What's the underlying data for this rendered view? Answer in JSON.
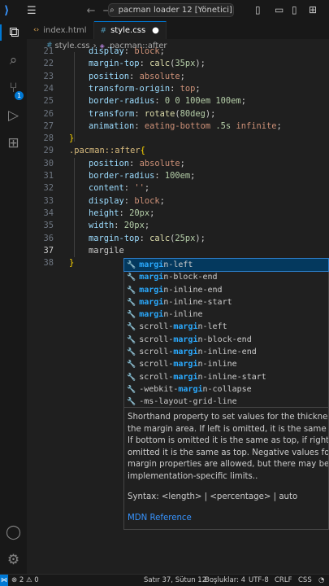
{
  "titlebar": {
    "search_text": "pacman loader 12 [Yönetici]",
    "back_icon": "arrow-left-icon",
    "forward_icon": "arrow-right-icon"
  },
  "activity_bar": {
    "source_control_badge": "1"
  },
  "tabs": [
    {
      "label": "index.html",
      "icon": "html-file-icon",
      "active": false,
      "modified": false
    },
    {
      "label": "style.css",
      "icon": "css-file-icon",
      "active": true,
      "modified": true
    }
  ],
  "breadcrumb": {
    "file": "style.css",
    "symbol": ".pacman::after"
  },
  "editor": {
    "current_line": "37",
    "lines": [
      {
        "n": "21",
        "tokens": [
          [
            "p",
            "display"
          ],
          [
            "t",
            ": "
          ],
          [
            "v",
            "block"
          ],
          [
            "t",
            ";"
          ]
        ]
      },
      {
        "n": "22",
        "tokens": [
          [
            "p",
            "margin-top"
          ],
          [
            "t",
            ": "
          ],
          [
            "f",
            "calc"
          ],
          [
            "t",
            "("
          ],
          [
            "n",
            "35px"
          ],
          [
            "t",
            ");"
          ]
        ]
      },
      {
        "n": "23",
        "tokens": [
          [
            "p",
            "position"
          ],
          [
            "t",
            ": "
          ],
          [
            "v",
            "absolute"
          ],
          [
            "t",
            ";"
          ]
        ]
      },
      {
        "n": "24",
        "tokens": [
          [
            "p",
            "transform-origin"
          ],
          [
            "t",
            ": "
          ],
          [
            "v",
            "top"
          ],
          [
            "t",
            ";"
          ]
        ]
      },
      {
        "n": "25",
        "tokens": [
          [
            "p",
            "border-radius"
          ],
          [
            "t",
            ": "
          ],
          [
            "n",
            "0 0 100em 100em"
          ],
          [
            "t",
            ";"
          ]
        ]
      },
      {
        "n": "26",
        "tokens": [
          [
            "p",
            "transform"
          ],
          [
            "t",
            ": "
          ],
          [
            "f",
            "rotate"
          ],
          [
            "t",
            "("
          ],
          [
            "n",
            "80deg"
          ],
          [
            "t",
            ");"
          ]
        ]
      },
      {
        "n": "27",
        "tokens": [
          [
            "p",
            "animation"
          ],
          [
            "t",
            ": "
          ],
          [
            "v",
            "eating-bottom "
          ],
          [
            "n",
            ".5s"
          ],
          [
            "v",
            " infinite"
          ],
          [
            "t",
            ";"
          ]
        ]
      },
      {
        "n": "28",
        "tokens": [
          [
            "b",
            "}"
          ]
        ],
        "indent": false
      },
      {
        "n": "29",
        "tokens": [
          [
            "s",
            ".pacman::after"
          ],
          [
            "b",
            "{"
          ]
        ],
        "indent": false
      },
      {
        "n": "30",
        "tokens": [
          [
            "p",
            "position"
          ],
          [
            "t",
            ": "
          ],
          [
            "v",
            "absolute"
          ],
          [
            "t",
            ";"
          ]
        ]
      },
      {
        "n": "31",
        "tokens": [
          [
            "p",
            "border-radius"
          ],
          [
            "t",
            ": "
          ],
          [
            "n",
            "100em"
          ],
          [
            "t",
            ";"
          ]
        ]
      },
      {
        "n": "32",
        "tokens": [
          [
            "p",
            "content"
          ],
          [
            "t",
            ": "
          ],
          [
            "v",
            "''"
          ],
          [
            "t",
            ";"
          ]
        ]
      },
      {
        "n": "33",
        "tokens": [
          [
            "p",
            "display"
          ],
          [
            "t",
            ": "
          ],
          [
            "v",
            "block"
          ],
          [
            "t",
            ";"
          ]
        ]
      },
      {
        "n": "34",
        "tokens": [
          [
            "p",
            "height"
          ],
          [
            "t",
            ": "
          ],
          [
            "n",
            "20px"
          ],
          [
            "t",
            ";"
          ]
        ]
      },
      {
        "n": "35",
        "tokens": [
          [
            "p",
            "width"
          ],
          [
            "t",
            ": "
          ],
          [
            "n",
            "20px"
          ],
          [
            "t",
            ";"
          ]
        ]
      },
      {
        "n": "36",
        "tokens": [
          [
            "p",
            "margin-top"
          ],
          [
            "t",
            ": "
          ],
          [
            "f",
            "calc"
          ],
          [
            "t",
            "("
          ],
          [
            "n",
            "25px"
          ],
          [
            "t",
            ");"
          ]
        ]
      },
      {
        "n": "37",
        "tokens": [
          [
            "t",
            "margile"
          ]
        ]
      },
      {
        "n": "38",
        "tokens": [
          [
            "b",
            "}"
          ]
        ],
        "indent": false
      }
    ]
  },
  "suggestions": [
    {
      "pre": "",
      "hl": "margi",
      "mid": "n-",
      "hl2": "le",
      "post": "ft",
      "text": "margin-left"
    },
    {
      "text": "margin-block-end"
    },
    {
      "text": "margin-inline-end"
    },
    {
      "text": "margin-inline-start"
    },
    {
      "text": "margin-inline"
    },
    {
      "text": "scroll-margin-left"
    },
    {
      "text": "scroll-margin-block-end"
    },
    {
      "text": "scroll-margin-inline-end"
    },
    {
      "text": "scroll-margin-inline"
    },
    {
      "text": "scroll-margin-inline-start"
    },
    {
      "text": "-webkit-margin-collapse"
    },
    {
      "text": "-ms-layout-grid-line"
    }
  ],
  "docs": {
    "lines": [
      "Shorthand property to set values for the thickness of",
      "the margin area. If left is omitted, it is the same as r",
      "If bottom is omitted it is the same as top, if right is",
      "omitted it is the same as top. Negative values for",
      "margin properties are allowed, but there may be",
      "implementation-specific limits.."
    ],
    "syntax": "Syntax: <length> | <percentage> | auto",
    "link": "MDN Reference"
  },
  "statusbar": {
    "errors": "2",
    "warnings": "0",
    "position": "Satır 37, Sütun 12",
    "indent": "Boşluklar: 4",
    "encoding": "UTF-8",
    "eol": "CRLF",
    "language": "CSS"
  }
}
